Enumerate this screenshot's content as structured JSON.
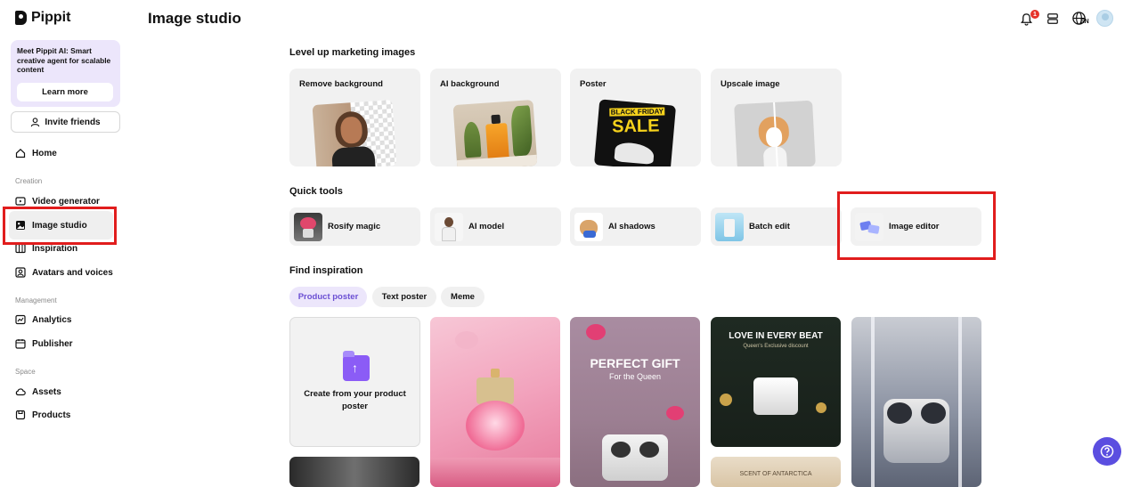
{
  "app": {
    "name": "Pippit"
  },
  "sidebar": {
    "promo": {
      "text": "Meet Pippit AI: Smart creative agent for scalable content",
      "button": "Learn more"
    },
    "invite": "Invite friends",
    "home": "Home",
    "sections": {
      "creation": "Creation",
      "management": "Management",
      "space": "Space"
    },
    "items": {
      "video_generator": "Video generator",
      "image_studio": "Image studio",
      "inspiration": "Inspiration",
      "avatars_and_voices": "Avatars and voices",
      "analytics": "Analytics",
      "publisher": "Publisher",
      "assets": "Assets",
      "products": "Products"
    }
  },
  "header": {
    "title": "Image studio",
    "notification_count": "1",
    "language": "EN"
  },
  "main": {
    "feature_heading": "Level up marketing images",
    "features": [
      "Remove background",
      "AI background",
      "Poster",
      "Upscale image"
    ],
    "poster_sample": {
      "line1": "BLACK FRIDAY",
      "line2": "SALE"
    },
    "quick_heading": "Quick tools",
    "quick_tools": [
      "Rosify magic",
      "AI model",
      "AI shadows",
      "Batch edit",
      "Image editor"
    ],
    "inspiration_heading": "Find inspiration",
    "tabs": [
      "Product poster",
      "Text poster",
      "Meme"
    ],
    "active_tab": "Product poster",
    "create_card": "Create from your product poster",
    "gallery_text": {
      "perfect_gift": "PERFECT GIFT",
      "for_the_queen": "For the Queen",
      "love_in_every_beat": "LOVE IN EVERY BEAT",
      "queens_discount": "Queen's Exclusive discount",
      "scent_of_antarctica": "SCENT OF ANTARCTICA"
    }
  },
  "colors": {
    "accent": "#6b4fd3",
    "promo_bg": "#ece6fb",
    "highlight": "#e11d1d",
    "help_button": "#5b4ee0"
  }
}
